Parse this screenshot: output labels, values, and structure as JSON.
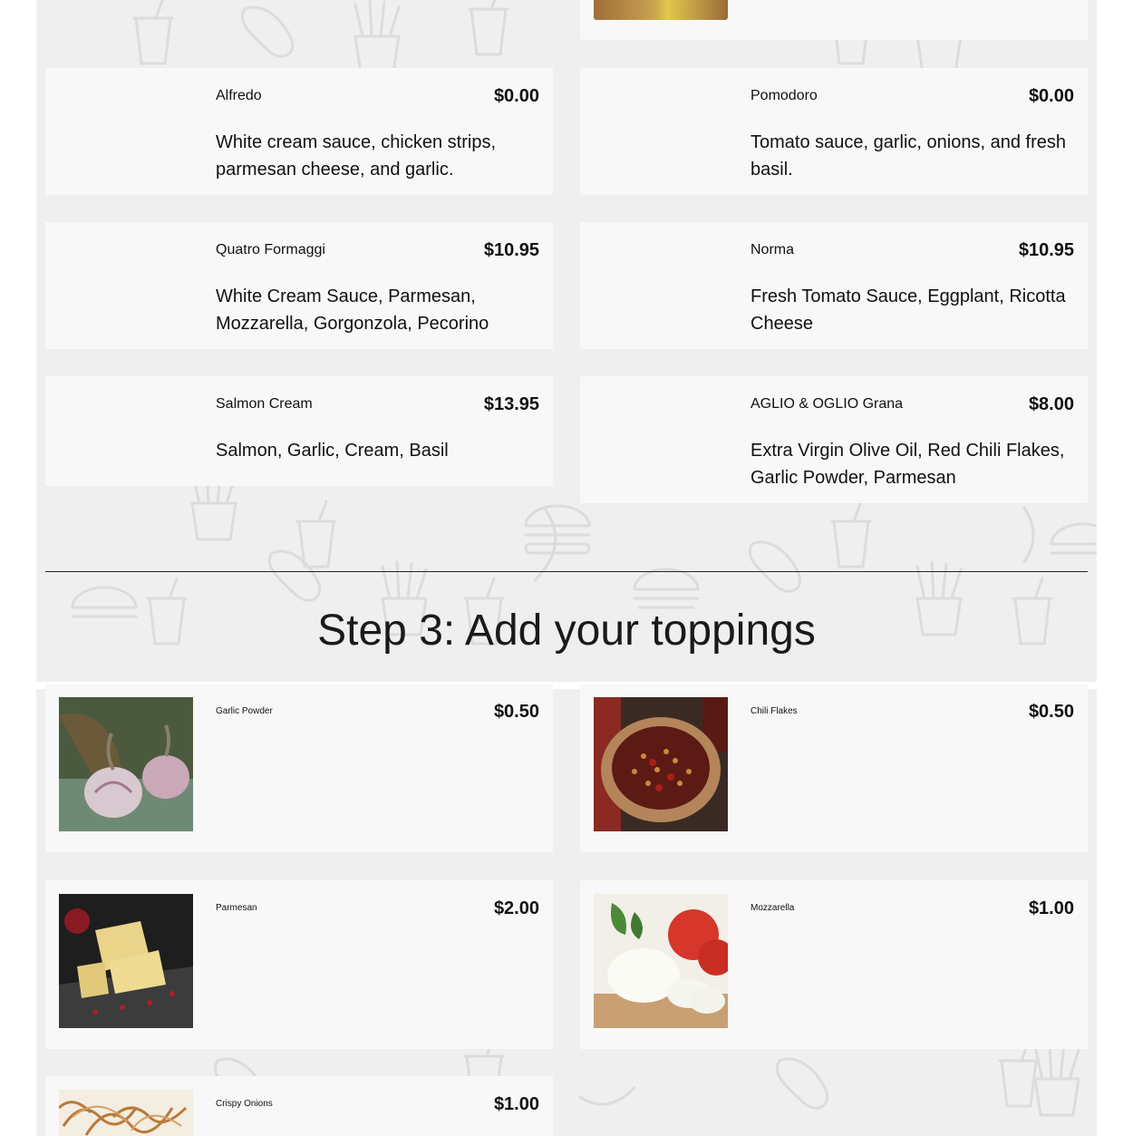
{
  "sauces": [
    {
      "name": "Alfredo",
      "price": "$0.00",
      "desc": "White cream sauce, chicken strips, parmesan cheese, and garlic."
    },
    {
      "name": "Pomodoro",
      "price": "$0.00",
      "desc": "Tomato sauce, garlic, onions, and fresh basil."
    },
    {
      "name": "Quatro Formaggi",
      "price": "$10.95",
      "desc": "White Cream Sauce, Parmesan, Mozzarella, Gorgonzola, Pecorino"
    },
    {
      "name": "Norma",
      "price": "$10.95",
      "desc": "Fresh Tomato Sauce, Eggplant, Ricotta Cheese"
    },
    {
      "name": "Salmon Cream",
      "price": "$13.95",
      "desc": "Salmon, Garlic, Cream, Basil"
    },
    {
      "name": "AGLIO & OGLIO Grana",
      "price": "$8.00",
      "desc": "Extra Virgin Olive Oil, Red Chili Flakes, Garlic Powder, Parmesan"
    }
  ],
  "step3": {
    "title": "Step 3: Add your toppings"
  },
  "toppings": [
    {
      "name": "Garlic Powder",
      "price": "$0.50",
      "image": "garlic-bulbs-photo"
    },
    {
      "name": "Chili Flakes",
      "price": "$0.50",
      "image": "chili-flakes-bowl-photo"
    },
    {
      "name": "Parmesan",
      "price": "$2.00",
      "image": "parmesan-cheese-photo"
    },
    {
      "name": "Mozzarella",
      "price": "$1.00",
      "image": "mozzarella-tomato-photo"
    },
    {
      "name": "Crispy Onions",
      "price": "$1.00",
      "image": "crispy-onions-photo"
    }
  ],
  "colors": {
    "background": "#efefef",
    "card": "#f8f8f8",
    "text": "#111111"
  }
}
